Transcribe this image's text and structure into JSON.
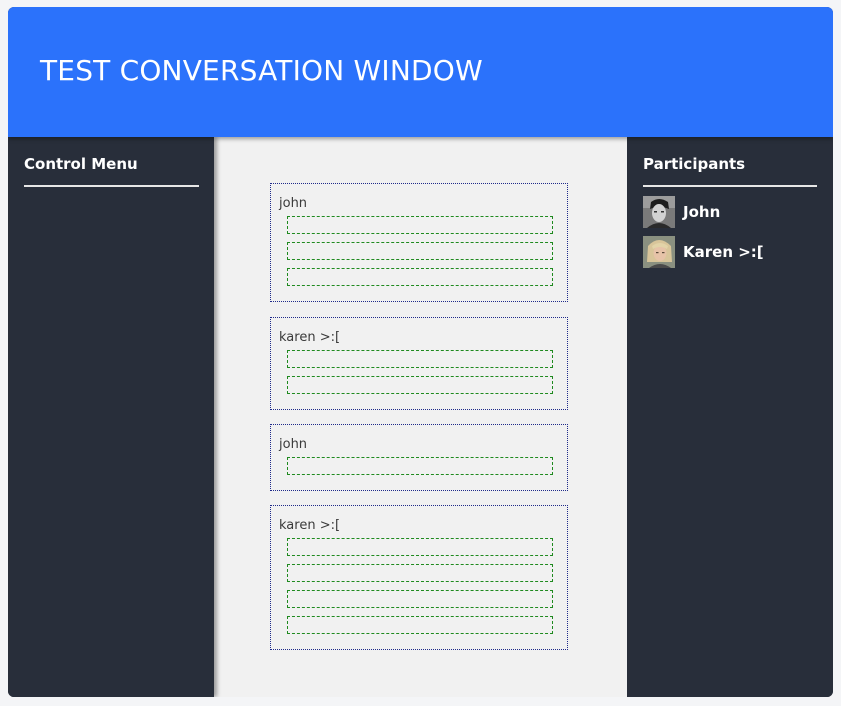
{
  "header": {
    "title": "TEST CONVERSATION WINDOW"
  },
  "control_menu": {
    "title": "Control Menu"
  },
  "conversation": {
    "messages": [
      {
        "author": "john",
        "line_count": 3
      },
      {
        "author": "karen >:[",
        "line_count": 2
      },
      {
        "author": "john",
        "line_count": 1
      },
      {
        "author": "karen >:[",
        "line_count": 4
      }
    ]
  },
  "participants": {
    "title": "Participants",
    "items": [
      {
        "name": "John",
        "avatar": "avatar-john-photo"
      },
      {
        "name": "Karen >:[",
        "avatar": "avatar-karen-photo"
      }
    ]
  },
  "colors": {
    "header_bg": "#2b72fb",
    "panel_bg": "#282e3a",
    "center_bg": "#f1f1f1",
    "message_border": "#1f2a8a",
    "line_border": "#1f8a1f"
  }
}
